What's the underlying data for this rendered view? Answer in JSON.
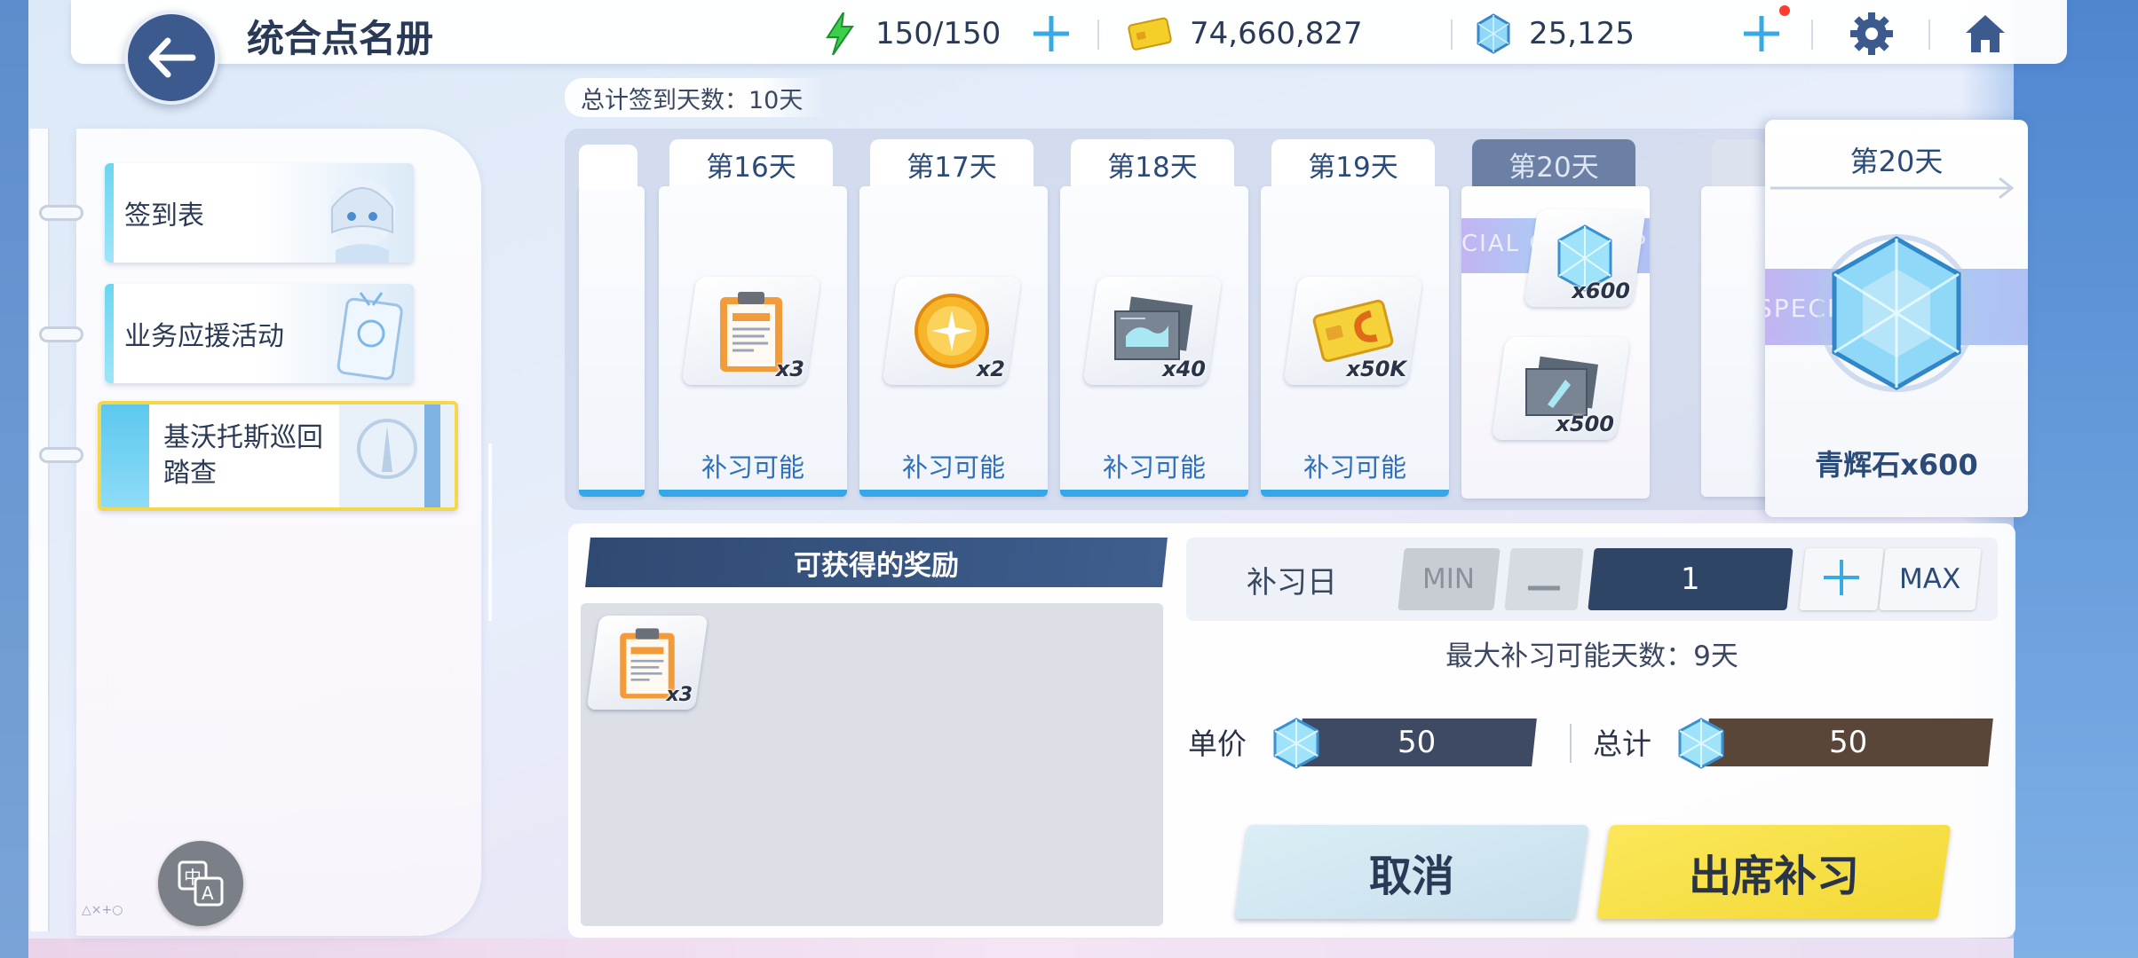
{
  "header": {
    "title": "统合点名册",
    "ap": "150/150",
    "credits": "74,660,827",
    "pyroxene": "25,125"
  },
  "sidebar": {
    "items": [
      {
        "label": "签到表"
      },
      {
        "label": "业务应援活动"
      },
      {
        "label": "基沃托斯巡回踏查"
      }
    ],
    "mini_logo": "△×+○"
  },
  "summary": {
    "total_days": "总计签到天数：10天"
  },
  "days": [
    {
      "label": "第16天",
      "qty": "x3",
      "status": "补习可能",
      "icon": "report-icon"
    },
    {
      "label": "第17天",
      "qty": "x2",
      "status": "补习可能",
      "icon": "gold-orb-icon"
    },
    {
      "label": "第18天",
      "qty": "x40",
      "status": "补习可能",
      "icon": "blueprint-icon"
    },
    {
      "label": "第19天",
      "qty": "x50K",
      "status": "补习可能",
      "icon": "credit-card-icon"
    },
    {
      "label": "第20天",
      "qty_gem": "x600",
      "qty_bp": "x500"
    }
  ],
  "feature": {
    "day": "第20天",
    "name": "青辉石x600",
    "band_text": "SPECIAL GIFT"
  },
  "rewards": {
    "title": "可获得的奖励",
    "items": [
      {
        "qty": "x3",
        "icon": "report-icon"
      }
    ]
  },
  "makeup": {
    "label": "补习日",
    "min": "MIN",
    "max": "MAX",
    "value": "1",
    "max_days": "最大补习可能天数：9天",
    "unit_price_label": "单价",
    "unit_price": "50",
    "total_label": "总计",
    "total": "50",
    "cancel": "取消",
    "confirm": "出席补习"
  },
  "colors": {
    "accent_blue": "#2e6fbd",
    "confirm_yellow": "#f3d936",
    "dark_navy": "#2f4566"
  }
}
